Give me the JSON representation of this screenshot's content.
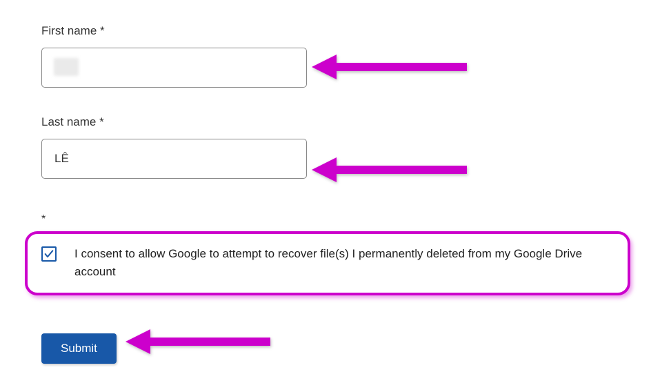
{
  "form": {
    "firstName": {
      "label": "First name *",
      "value": ""
    },
    "lastName": {
      "label": "Last name *",
      "value": "LÊ"
    },
    "consent": {
      "requiredMark": "*",
      "checked": true,
      "text": "I consent to allow Google to attempt to recover file(s) I permanently deleted from my Google Drive account"
    },
    "submit": {
      "label": "Submit"
    }
  },
  "annotations": {
    "highlightColor": "#cc00cc"
  }
}
